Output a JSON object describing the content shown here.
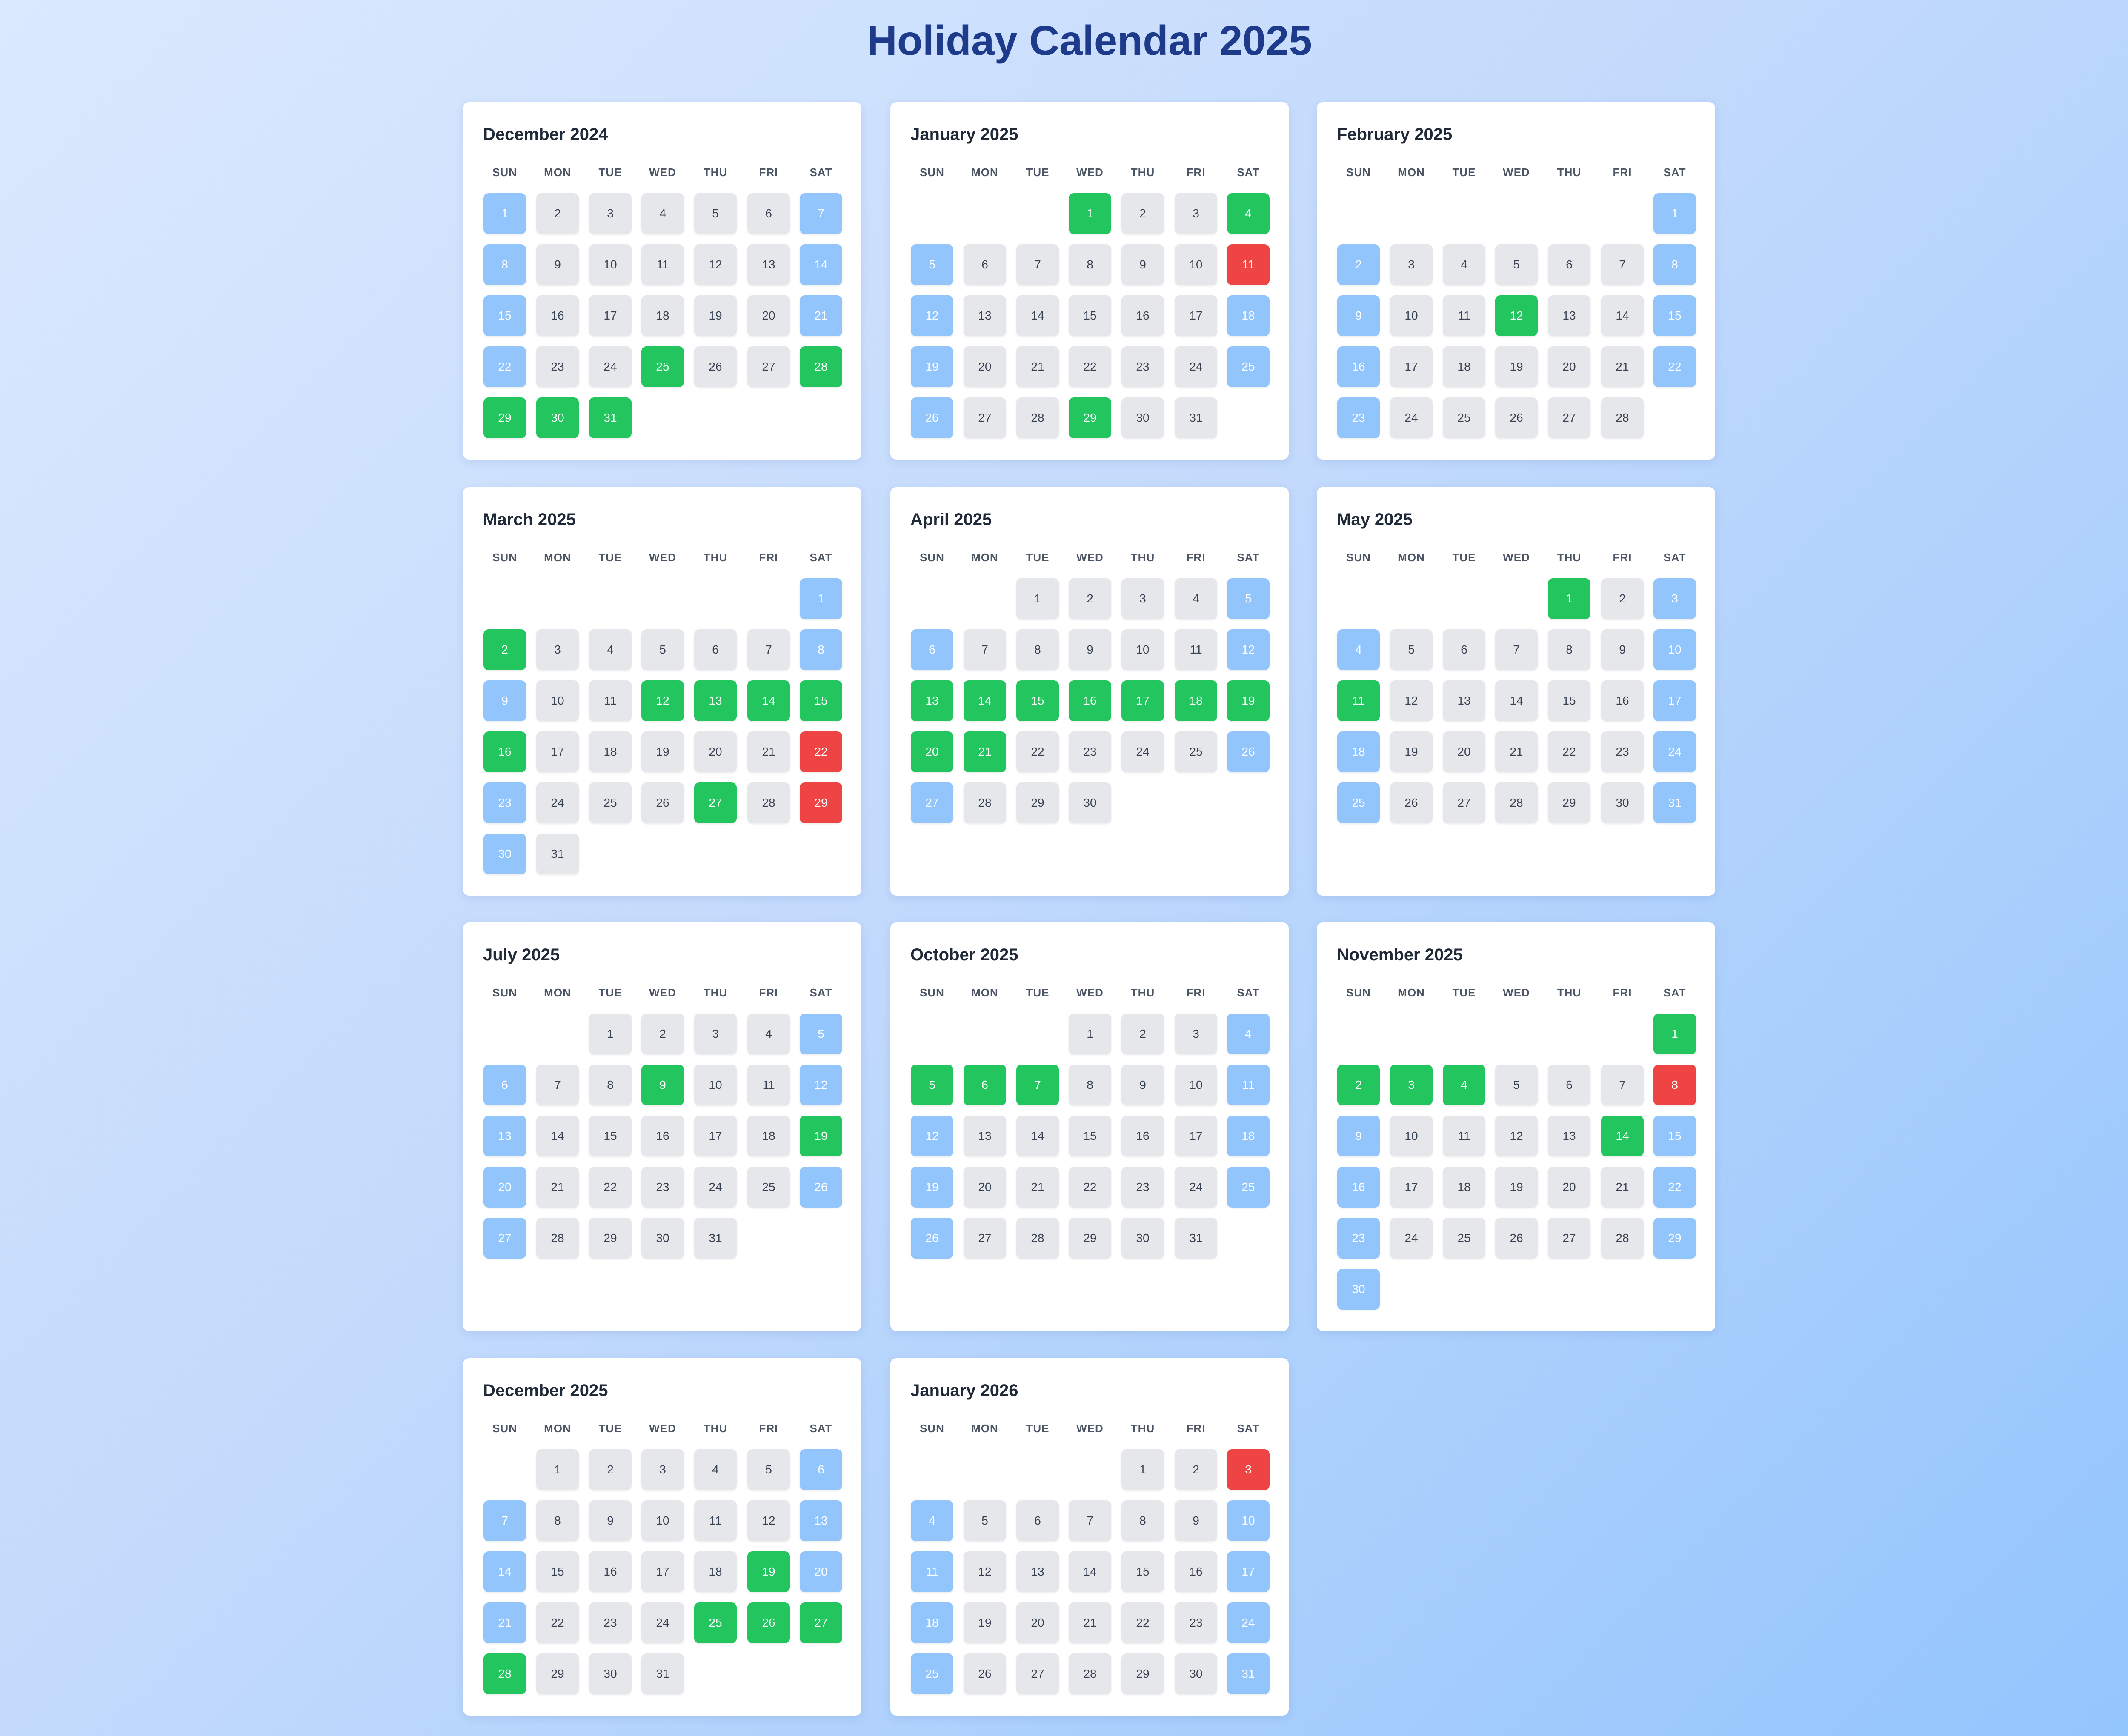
{
  "page": {
    "title": "Holiday Calendar 2025"
  },
  "weekday_labels": [
    "SUN",
    "MON",
    "TUE",
    "WED",
    "THU",
    "FRI",
    "SAT"
  ],
  "colors": {
    "normal_day": "#e5e7eb",
    "weekend_day": "#93c5fd",
    "holiday_green": "#22c55e",
    "holiday_red": "#ef4444",
    "title": "#1e3a8a"
  },
  "months": [
    {
      "name": "December 2024",
      "first_weekday": 0,
      "days_in_month": 31,
      "green": [
        25,
        28,
        29,
        30,
        31
      ],
      "red": []
    },
    {
      "name": "January 2025",
      "first_weekday": 3,
      "days_in_month": 31,
      "green": [
        1,
        4,
        29
      ],
      "red": [
        11
      ]
    },
    {
      "name": "February 2025",
      "first_weekday": 6,
      "days_in_month": 28,
      "green": [
        12
      ],
      "red": []
    },
    {
      "name": "March 2025",
      "first_weekday": 6,
      "days_in_month": 31,
      "green": [
        2,
        12,
        13,
        14,
        15,
        16,
        27
      ],
      "red": [
        22,
        29
      ]
    },
    {
      "name": "April 2025",
      "first_weekday": 2,
      "days_in_month": 30,
      "green": [
        13,
        14,
        15,
        16,
        17,
        18,
        19,
        20,
        21
      ],
      "red": []
    },
    {
      "name": "May 2025",
      "first_weekday": 4,
      "days_in_month": 31,
      "green": [
        1,
        11
      ],
      "red": []
    },
    {
      "name": "July 2025",
      "first_weekday": 2,
      "days_in_month": 31,
      "green": [
        9,
        19
      ],
      "red": []
    },
    {
      "name": "October 2025",
      "first_weekday": 3,
      "days_in_month": 31,
      "green": [
        5,
        6,
        7
      ],
      "red": []
    },
    {
      "name": "November 2025",
      "first_weekday": 6,
      "days_in_month": 30,
      "green": [
        1,
        2,
        3,
        4,
        14
      ],
      "red": [
        8
      ]
    },
    {
      "name": "December 2025",
      "first_weekday": 1,
      "days_in_month": 31,
      "green": [
        19,
        25,
        26,
        27,
        28
      ],
      "red": []
    },
    {
      "name": "January 2026",
      "first_weekday": 4,
      "days_in_month": 31,
      "green": [],
      "red": [
        3
      ]
    }
  ]
}
